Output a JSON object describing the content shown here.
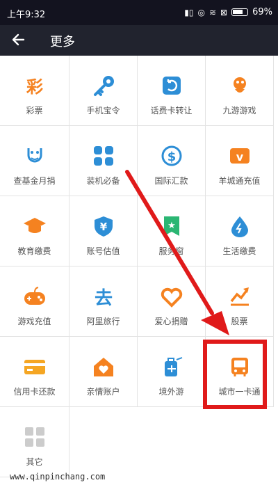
{
  "status_bar": {
    "time": "上午9:32",
    "battery": "69%"
  },
  "navbar": {
    "title": "更多",
    "back_icon": "arrow-left-icon"
  },
  "grid_items": [
    {
      "label": "彩票",
      "icon": "lottery-icon",
      "color": "#f58220"
    },
    {
      "label": "手机宝令",
      "icon": "key-icon",
      "color": "#2d8ed6"
    },
    {
      "label": "话费卡转让",
      "icon": "transfer-icon",
      "color": "#2d8ed6"
    },
    {
      "label": "九游游戏",
      "icon": "game-character-icon",
      "color": "#f58220"
    },
    {
      "label": "查基金月捐",
      "icon": "smile-face-icon",
      "color": "#2d8ed6"
    },
    {
      "label": "装机必备",
      "icon": "apps-grid-icon",
      "color": "#2d8ed6"
    },
    {
      "label": "国际汇款",
      "icon": "dollar-icon",
      "color": "#2d8ed6"
    },
    {
      "label": "羊城通充值",
      "icon": "card-v-icon",
      "color": "#f58220"
    },
    {
      "label": "教育缴费",
      "icon": "graduation-cap-icon",
      "color": "#f58220"
    },
    {
      "label": "账号估值",
      "icon": "shield-yen-icon",
      "color": "#2d8ed6"
    },
    {
      "label": "服务窗",
      "icon": "bookmark-star-icon",
      "color": "#2bb673"
    },
    {
      "label": "生活缴费",
      "icon": "water-drop-icon",
      "color": "#2d8ed6"
    },
    {
      "label": "游戏充值",
      "icon": "gamepad-icon",
      "color": "#f58220"
    },
    {
      "label": "阿里旅行",
      "icon": "travel-icon",
      "color": "#2d8ed6"
    },
    {
      "label": "爱心捐赠",
      "icon": "heart-icon",
      "color": "#f58220"
    },
    {
      "label": "股票",
      "icon": "stock-chart-icon",
      "color": "#f58220"
    },
    {
      "label": "信用卡还款",
      "icon": "credit-card-icon",
      "color": "#f5a623"
    },
    {
      "label": "亲情账户",
      "icon": "home-heart-icon",
      "color": "#f58220"
    },
    {
      "label": "境外游",
      "icon": "luggage-plane-icon",
      "color": "#2d8ed6"
    },
    {
      "label": "城市一卡通",
      "icon": "bus-icon",
      "color": "#f58220"
    },
    {
      "label": "其它",
      "icon": "more-grid-icon",
      "color": "#cccccc"
    }
  ],
  "watermark": "www.qinpinchang.com",
  "highlight": {
    "color": "#e01a1a",
    "target": "城市一卡通"
  }
}
